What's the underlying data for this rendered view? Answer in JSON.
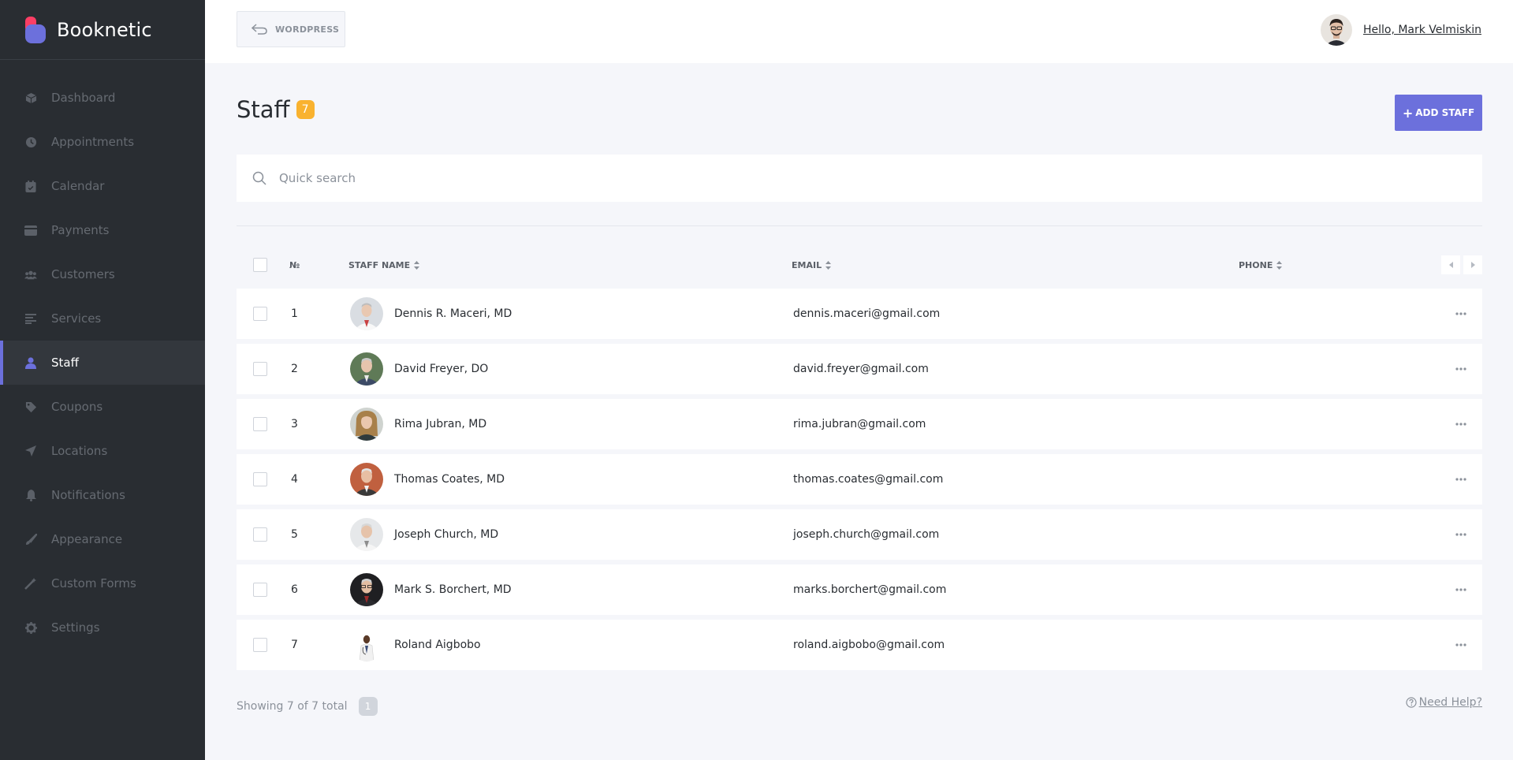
{
  "brand": {
    "name": "Booknetic",
    "primary_color": "#6c70dc",
    "logo_colors": [
      "#fc3e65",
      "#6c70dc"
    ]
  },
  "sidebar": {
    "items": [
      {
        "label": "Dashboard",
        "icon": "cube-icon"
      },
      {
        "label": "Appointments",
        "icon": "clock-icon"
      },
      {
        "label": "Calendar",
        "icon": "calendar-icon"
      },
      {
        "label": "Payments",
        "icon": "credit-card-icon"
      },
      {
        "label": "Customers",
        "icon": "users-icon"
      },
      {
        "label": "Services",
        "icon": "list-icon"
      },
      {
        "label": "Staff",
        "icon": "user-icon",
        "active": true
      },
      {
        "label": "Coupons",
        "icon": "tag-icon"
      },
      {
        "label": "Locations",
        "icon": "location-arrow-icon"
      },
      {
        "label": "Notifications",
        "icon": "bell-icon"
      },
      {
        "label": "Appearance",
        "icon": "brush-icon"
      },
      {
        "label": "Custom Forms",
        "icon": "magic-wand-icon"
      },
      {
        "label": "Settings",
        "icon": "gear-icon"
      }
    ]
  },
  "topbar": {
    "wordpress_label": "WORDPRESS",
    "user_greeting": "Hello, Mark Velmiskin"
  },
  "page": {
    "title": "Staff",
    "count": "7",
    "add_button_label": "ADD STAFF",
    "add_button_plus": "+",
    "search_placeholder": "Quick search"
  },
  "table": {
    "headers": {
      "num": "№",
      "name": "STAFF NAME",
      "email": "EMAIL",
      "phone": "PHONE"
    },
    "rows": [
      {
        "num": "1",
        "name": "Dennis R. Maceri, MD",
        "email": "dennis.maceri@gmail.com",
        "phone": ""
      },
      {
        "num": "2",
        "name": "David Freyer, DO",
        "email": "david.freyer@gmail.com",
        "phone": ""
      },
      {
        "num": "3",
        "name": "Rima Jubran, MD",
        "email": "rima.jubran@gmail.com",
        "phone": ""
      },
      {
        "num": "4",
        "name": "Thomas Coates, MD",
        "email": "thomas.coates@gmail.com",
        "phone": ""
      },
      {
        "num": "5",
        "name": "Joseph Church, MD",
        "email": "joseph.church@gmail.com",
        "phone": ""
      },
      {
        "num": "6",
        "name": "Mark S. Borchert, MD",
        "email": "marks.borchert@gmail.com",
        "phone": ""
      },
      {
        "num": "7",
        "name": "Roland Aigbobo",
        "email": "roland.aigbobo@gmail.com",
        "phone": ""
      }
    ]
  },
  "footer": {
    "showing_text": "Showing 7 of 7 total",
    "current_page": "1",
    "help_label": "Need Help?"
  }
}
